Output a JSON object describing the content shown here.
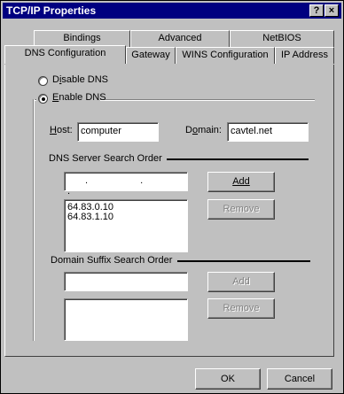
{
  "window": {
    "title": "TCP/IP Properties",
    "help_glyph": "?",
    "close_glyph": "×"
  },
  "tabs_back": [
    "Bindings",
    "Advanced",
    "NetBIOS"
  ],
  "tabs_front": [
    "DNS Configuration",
    "Gateway",
    "WINS Configuration",
    "IP Address"
  ],
  "dns": {
    "disable_label": "Disable DNS",
    "enable_label": "Enable DNS",
    "selected": "enable",
    "host_label": "Host:",
    "host_value": "computer",
    "domain_label": "Domain:",
    "domain_value": "cavtel.net",
    "server_order_label": "DNS Server Search Order",
    "server_ip_dots": ". . .",
    "servers": [
      "64.83.0.10",
      "64.83.1.10"
    ],
    "add_label": "Add",
    "remove_label": "Remove",
    "suffix_label": "Domain Suffix Search Order",
    "suffix_add_label": "Add",
    "suffix_remove_label": "Remove"
  },
  "footer": {
    "ok_label": "OK",
    "cancel_label": "Cancel"
  }
}
